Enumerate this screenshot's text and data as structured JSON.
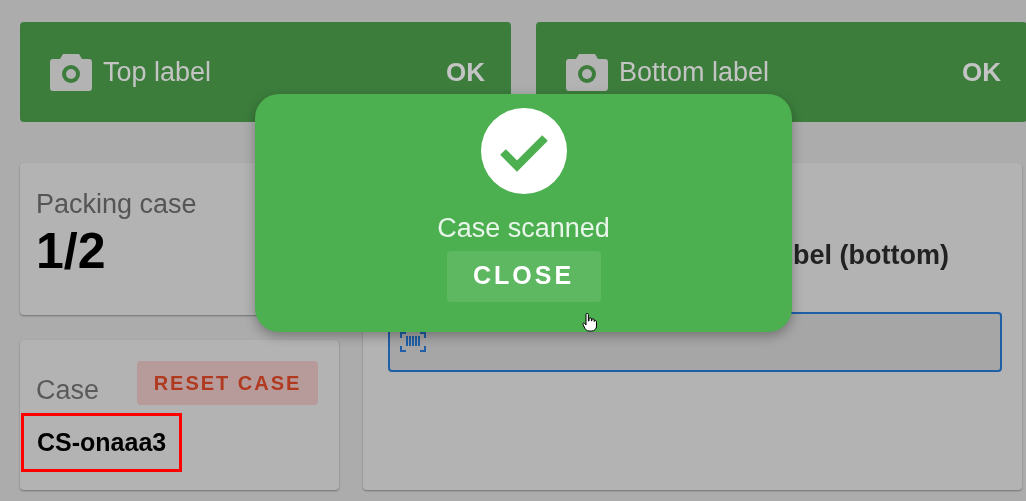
{
  "status_cards": [
    {
      "label": "Top label",
      "status": "OK"
    },
    {
      "label": "Bottom label",
      "status": "OK"
    }
  ],
  "packing_case": {
    "label": "Packing case",
    "value": "1/2"
  },
  "case": {
    "label": "Case",
    "reset_button": "RESET CASE",
    "code": "CS-onaaa3"
  },
  "scan_panel": {
    "heading": "bel (bottom)"
  },
  "dialog": {
    "message": "Case scanned",
    "button": "CLOSE"
  }
}
